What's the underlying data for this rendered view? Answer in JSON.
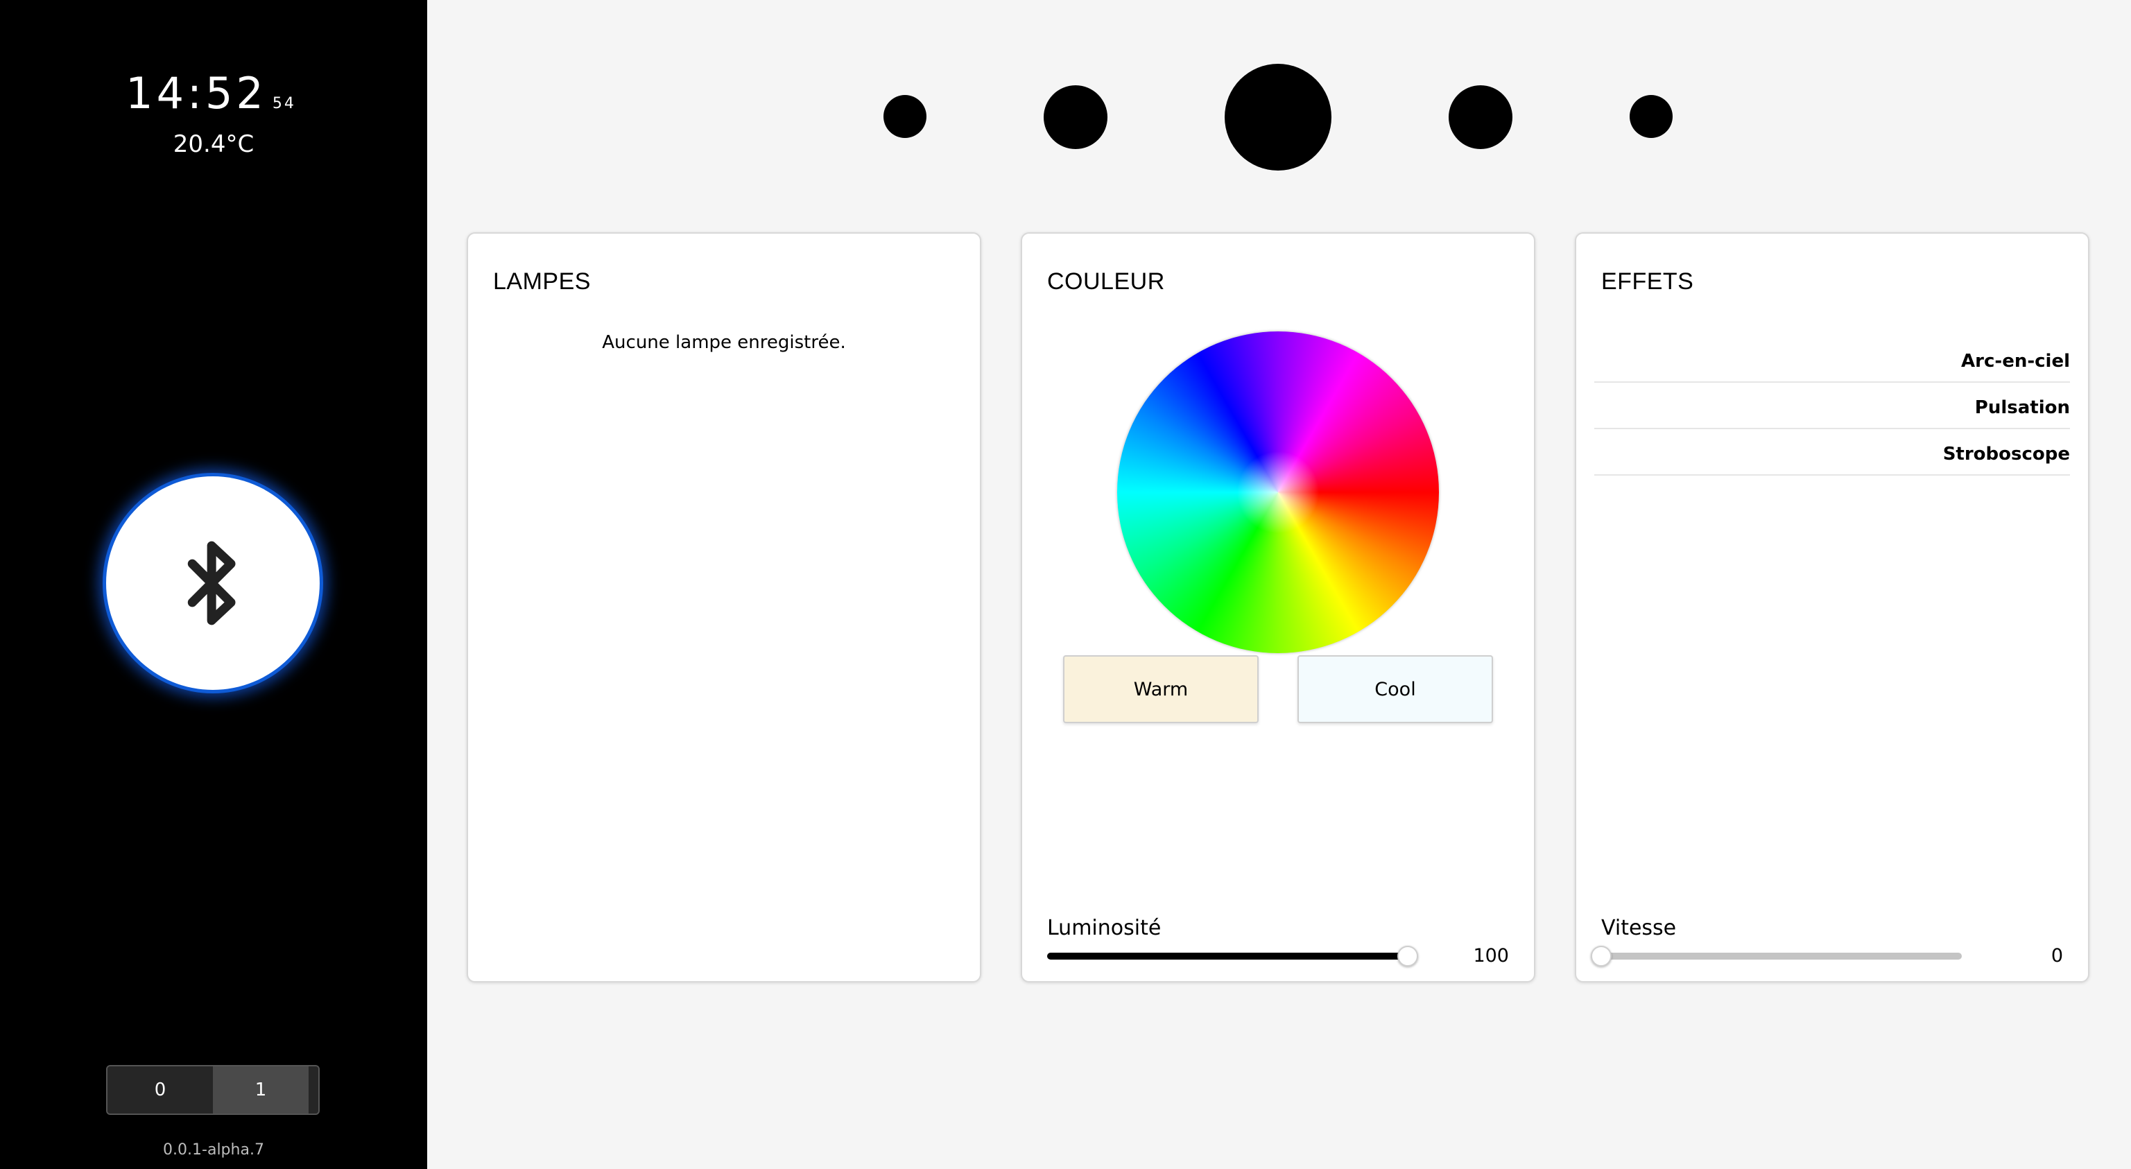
{
  "sidebar": {
    "clock": {
      "time": "14:52",
      "seconds": "54"
    },
    "temperature": "20.4°C",
    "bluetooth_icon": "bluetooth-icon",
    "toggle": {
      "options": [
        "0",
        "1"
      ],
      "selected": "1"
    },
    "version": "0.0.1-alpha.7"
  },
  "dots": {
    "count": 5,
    "selected_index": 2
  },
  "lampes": {
    "title": "LAMPES",
    "empty_message": "Aucune lampe enregistrée."
  },
  "couleur": {
    "title": "COULEUR",
    "warm_label": "Warm",
    "cool_label": "Cool",
    "warm_color": "#faf2dc",
    "cool_color": "#f3fbfe",
    "brightness": {
      "label": "Luminosité",
      "value": "100",
      "min": 0,
      "max": 100
    }
  },
  "effets": {
    "title": "EFFETS",
    "items": [
      "Arc-en-ciel",
      "Pulsation",
      "Stroboscope"
    ],
    "speed": {
      "label": "Vitesse",
      "value": "0",
      "min": 0,
      "max": 100
    }
  },
  "colors": {
    "sidebar_bg": "#000000",
    "page_bg": "#f5f5f5",
    "bluetooth_glow": "#0f5bd6"
  }
}
